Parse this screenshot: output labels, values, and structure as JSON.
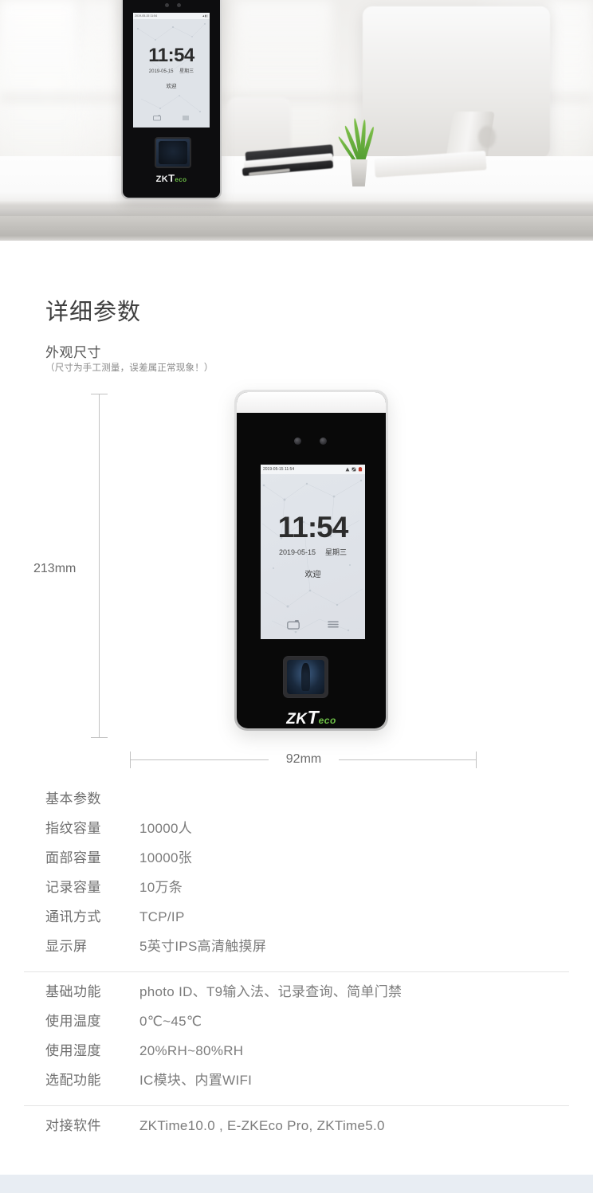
{
  "hero": {
    "alt": "product-photo-desk-scene",
    "device_screen": {
      "status_time": "2019-05-15 11:54",
      "clock": "11:54",
      "date": "2019-05-15",
      "weekday": "星期三",
      "welcome": "欢迎",
      "nav_icons": [
        "camera-icon",
        "menu-icon"
      ],
      "status_icons": [
        "signal-icon",
        "network-icon",
        "battery-icon"
      ]
    },
    "brand": {
      "zk": "ZK",
      "t": "T",
      "eco": "eco"
    }
  },
  "section": {
    "title": "详细参数",
    "subtitle": "外观尺寸",
    "note": "（尺寸为手工测量，误差属正常现象！）"
  },
  "diagram": {
    "height_label": "213mm",
    "width_label": "92mm",
    "device": {
      "status_time": "2019-05-15 11:54",
      "clock": "11:54",
      "date": "2019-05-15",
      "weekday": "星期三",
      "welcome": "欢迎",
      "brand": {
        "zk": "ZK",
        "t": "T",
        "eco": "eco"
      }
    }
  },
  "specs": {
    "groups": [
      {
        "header": "基本参数",
        "rows": [
          {
            "key": "指纹容量",
            "value": "10000人"
          },
          {
            "key": "面部容量",
            "value": "10000张"
          },
          {
            "key": "记录容量",
            "value": "10万条"
          },
          {
            "key": "通讯方式",
            "value": "TCP/IP"
          },
          {
            "key": "显示屏",
            "value": "5英寸IPS高清触摸屏"
          }
        ]
      },
      {
        "header": "",
        "rows": [
          {
            "key": "基础功能",
            "value": "photo ID、T9输入法、记录查询、简单门禁"
          },
          {
            "key": "使用温度",
            "value": "0℃~45℃"
          },
          {
            "key": "使用湿度",
            "value": "20%RH~80%RH"
          },
          {
            "key": "选配功能",
            "value": "IC模块、内置WIFI"
          }
        ]
      },
      {
        "header": "",
        "rows": [
          {
            "key": "对接软件",
            "value": "ZKTime10.0 , E-ZKEco Pro, ZKTime5.0"
          }
        ]
      }
    ]
  },
  "colors": {
    "brand_green": "#6cbe45",
    "text_gray": "#6e6e6e",
    "value_gray": "#7c7c7c",
    "divider": "#e4e4e4",
    "dimension_line": "#c2c2c2",
    "screen_bg": "#dfe3e9",
    "bottom_band": "#e8edf3"
  }
}
